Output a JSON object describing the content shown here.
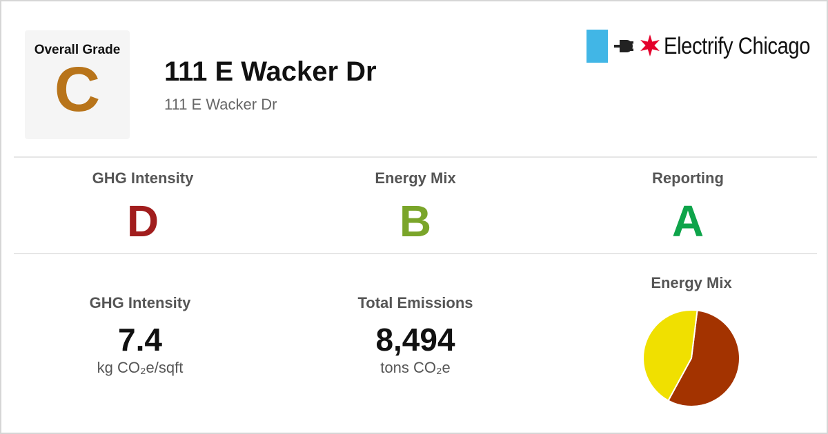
{
  "overall": {
    "label": "Overall Grade",
    "grade": "C",
    "grade_color": "#b8741a"
  },
  "building": {
    "name": "111 E Wacker Dr",
    "address": "111 E Wacker Dr"
  },
  "brand": {
    "name": "Electrify Chicago",
    "blue": "#41b6e6",
    "red": "#e4002b"
  },
  "grades": [
    {
      "label": "GHG Intensity",
      "grade": "D",
      "color": "#a11d1d"
    },
    {
      "label": "Energy Mix",
      "grade": "B",
      "color": "#7aa52a"
    },
    {
      "label": "Reporting",
      "grade": "A",
      "color": "#0ea44a"
    }
  ],
  "metrics": [
    {
      "label": "GHG Intensity",
      "value": "7.4",
      "unit": "kg CO₂e/sqft"
    },
    {
      "label": "Total Emissions",
      "value": "8,494",
      "unit": "tons CO₂e"
    }
  ],
  "energy_mix": {
    "title": "Energy Mix",
    "slices": [
      {
        "share": 0.56,
        "color": "#a33300"
      },
      {
        "share": 0.44,
        "color": "#f0e000"
      }
    ]
  }
}
